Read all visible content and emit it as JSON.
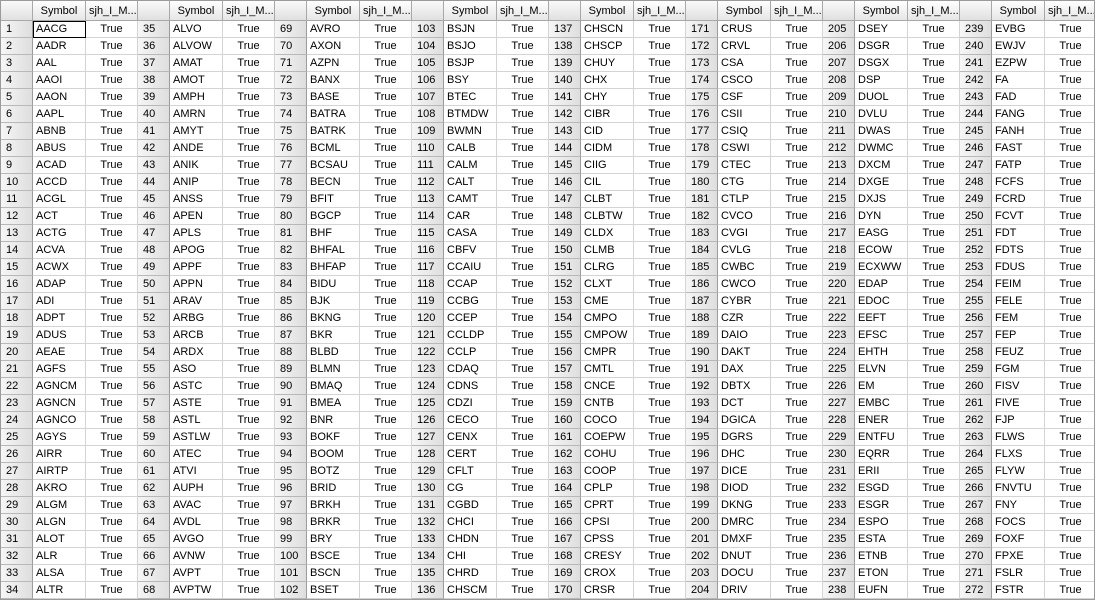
{
  "columns": {
    "symbol": "Symbol",
    "value": "sjh_I_M..."
  },
  "selected_cell": "AACG",
  "blocks": [
    {
      "start": 1,
      "value": "True",
      "symbols": [
        "AACG",
        "AADR",
        "AAL",
        "AAOI",
        "AAON",
        "AAPL",
        "ABNB",
        "ABUS",
        "ACAD",
        "ACCD",
        "ACGL",
        "ACT",
        "ACTG",
        "ACVA",
        "ACWX",
        "ADAP",
        "ADI",
        "ADPT",
        "ADUS",
        "AEAE",
        "AGFS",
        "AGNCM",
        "AGNCN",
        "AGNCO",
        "AGYS",
        "AIRR",
        "AIRTP",
        "AKRO",
        "ALGM",
        "ALGN",
        "ALOT",
        "ALR",
        "ALSA",
        "ALTR"
      ]
    },
    {
      "start": 35,
      "value": "True",
      "symbols": [
        "ALVO",
        "ALVOW",
        "AMAT",
        "AMOT",
        "AMPH",
        "AMRN",
        "AMYT",
        "ANDE",
        "ANIK",
        "ANIP",
        "ANSS",
        "APEN",
        "APLS",
        "APOG",
        "APPF",
        "APPN",
        "ARAV",
        "ARBG",
        "ARCB",
        "ARDX",
        "ASO",
        "ASTC",
        "ASTE",
        "ASTL",
        "ASTLW",
        "ATEC",
        "ATVI",
        "AUPH",
        "AVAC",
        "AVDL",
        "AVGO",
        "AVNW",
        "AVPT",
        "AVPTW"
      ]
    },
    {
      "start": 69,
      "value": "True",
      "symbols": [
        "AVRO",
        "AXON",
        "AZPN",
        "BANX",
        "BASE",
        "BATRA",
        "BATRK",
        "BCML",
        "BCSAU",
        "BECN",
        "BFIT",
        "BGCP",
        "BHF",
        "BHFAL",
        "BHFAP",
        "BIDU",
        "BJK",
        "BKNG",
        "BKR",
        "BLBD",
        "BLMN",
        "BMAQ",
        "BMEA",
        "BNR",
        "BOKF",
        "BOOM",
        "BOTZ",
        "BRID",
        "BRKH",
        "BRKR",
        "BRY",
        "BSCE",
        "BSCN",
        "BSET"
      ]
    },
    {
      "start": 103,
      "value": "True",
      "symbols": [
        "BSJN",
        "BSJO",
        "BSJP",
        "BSY",
        "BTEC",
        "BTMDW",
        "BWMN",
        "CALB",
        "CALM",
        "CALT",
        "CAMT",
        "CAR",
        "CASA",
        "CBFV",
        "CCAIU",
        "CCAP",
        "CCBG",
        "CCEP",
        "CCLDP",
        "CCLP",
        "CDAQ",
        "CDNS",
        "CDZI",
        "CECO",
        "CENX",
        "CERT",
        "CFLT",
        "CG",
        "CGBD",
        "CHCI",
        "CHDN",
        "CHI",
        "CHRD",
        "CHSCM"
      ]
    },
    {
      "start": 137,
      "value": "True",
      "symbols": [
        "CHSCN",
        "CHSCP",
        "CHUY",
        "CHX",
        "CHY",
        "CIBR",
        "CID",
        "CIDM",
        "CIIG",
        "CIL",
        "CLBT",
        "CLBTW",
        "CLDX",
        "CLMB",
        "CLRG",
        "CLXT",
        "CME",
        "CMPO",
        "CMPOW",
        "CMPR",
        "CMTL",
        "CNCE",
        "CNTB",
        "COCO",
        "COEPW",
        "COHU",
        "COOP",
        "CPLP",
        "CPRT",
        "CPSI",
        "CPSS",
        "CRESY",
        "CROX",
        "CRSR"
      ]
    },
    {
      "start": 171,
      "value": "True",
      "symbols": [
        "CRUS",
        "CRVL",
        "CSA",
        "CSCO",
        "CSF",
        "CSII",
        "CSIQ",
        "CSWI",
        "CTEC",
        "CTG",
        "CTLP",
        "CVCO",
        "CVGI",
        "CVLG",
        "CWBC",
        "CWCO",
        "CYBR",
        "CZR",
        "DAIO",
        "DAKT",
        "DAX",
        "DBTX",
        "DCT",
        "DGICA",
        "DGRS",
        "DHC",
        "DICE",
        "DIOD",
        "DKNG",
        "DMRC",
        "DMXF",
        "DNUT",
        "DOCU",
        "DRIV"
      ]
    },
    {
      "start": 205,
      "value": "True",
      "symbols": [
        "DSEY",
        "DSGR",
        "DSGX",
        "DSP",
        "DUOL",
        "DVLU",
        "DWAS",
        "DWMC",
        "DXCM",
        "DXGE",
        "DXJS",
        "DYN",
        "EASG",
        "ECOW",
        "ECXWW",
        "EDAP",
        "EDOC",
        "EEFT",
        "EFSC",
        "EHTH",
        "ELVN",
        "EM",
        "EMBC",
        "ENER",
        "ENTFU",
        "EQRR",
        "ERII",
        "ESGD",
        "ESGR",
        "ESPO",
        "ESTA",
        "ETNB",
        "ETON",
        "EUFN"
      ]
    },
    {
      "start": 239,
      "value": "True",
      "symbols": [
        "EVBG",
        "EWJV",
        "EZPW",
        "FA",
        "FAD",
        "FANG",
        "FANH",
        "FAST",
        "FATP",
        "FCFS",
        "FCRD",
        "FCVT",
        "FDT",
        "FDTS",
        "FDUS",
        "FEIM",
        "FELE",
        "FEM",
        "FEP",
        "FEUZ",
        "FGM",
        "FISV",
        "FIVE",
        "FJP",
        "FLWS",
        "FLXS",
        "FLYW",
        "FNVTU",
        "FNY",
        "FOCS",
        "FOXF",
        "FPXE",
        "FSLR",
        "FSTR"
      ]
    }
  ]
}
